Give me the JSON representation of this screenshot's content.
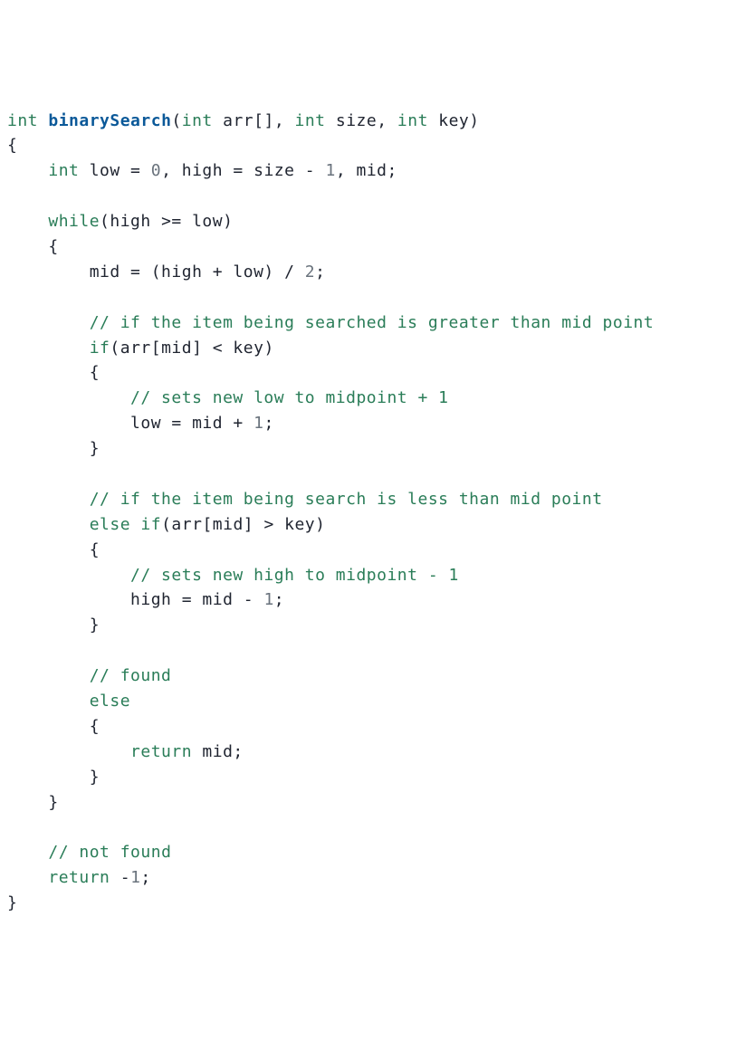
{
  "code": {
    "l1": {
      "kw_int": "int",
      "fn": "binarySearch",
      "po": "(",
      "kw_int2": "int",
      "sp": " arr",
      "br": "[]",
      "c1": ", ",
      "kw_int3": "int",
      "size": " size",
      "c2": ", ",
      "kw_int4": "int",
      "key": " key",
      "pc": ")"
    },
    "l2": "{",
    "l3": {
      "indent": "    ",
      "kw_int": "int",
      "rest1": " low = ",
      "n0": "0",
      "rest2": ", high = size - ",
      "n1": "1",
      "rest3": ", mid;"
    },
    "l4": "",
    "l5": {
      "indent": "    ",
      "kw": "while",
      "rest": "(high >= low)"
    },
    "l6": "    {",
    "l7": {
      "indent": "        ",
      "rest1": "mid = (high + low) / ",
      "n": "2",
      "rest2": ";"
    },
    "l8": "",
    "l9": {
      "indent": "        ",
      "cmt": "// if the item being searched is greater than mid point"
    },
    "l10": {
      "indent": "        ",
      "kw": "if",
      "rest": "(arr[mid] < key)"
    },
    "l11": "        {",
    "l12": {
      "indent": "            ",
      "cmt": "// sets new low to midpoint + 1"
    },
    "l13": {
      "indent": "            ",
      "rest1": "low = mid + ",
      "n": "1",
      "rest2": ";"
    },
    "l14": "        }",
    "l15": "",
    "l16": {
      "indent": "        ",
      "cmt": "// if the item being search is less than mid point"
    },
    "l17": {
      "indent": "        ",
      "kw1": "else",
      "sp": " ",
      "kw2": "if",
      "rest": "(arr[mid] > key)"
    },
    "l18": "        {",
    "l19": {
      "indent": "            ",
      "cmt": "// sets new high to midpoint - 1"
    },
    "l20": {
      "indent": "            ",
      "rest1": "high = mid - ",
      "n": "1",
      "rest2": ";"
    },
    "l21": "        }",
    "l22": "",
    "l23": {
      "indent": "        ",
      "cmt": "// found"
    },
    "l24": {
      "indent": "        ",
      "kw": "else"
    },
    "l25": "        {",
    "l26": {
      "indent": "            ",
      "kw": "return",
      "rest": " mid;"
    },
    "l27": "        }",
    "l28": "    }",
    "l29": "",
    "l30": {
      "indent": "    ",
      "cmt": "// not found"
    },
    "l31": {
      "indent": "    ",
      "kw": "return",
      "sp": " ",
      "neg": "-",
      "n": "1",
      "semi": ";"
    },
    "l32": "}"
  }
}
